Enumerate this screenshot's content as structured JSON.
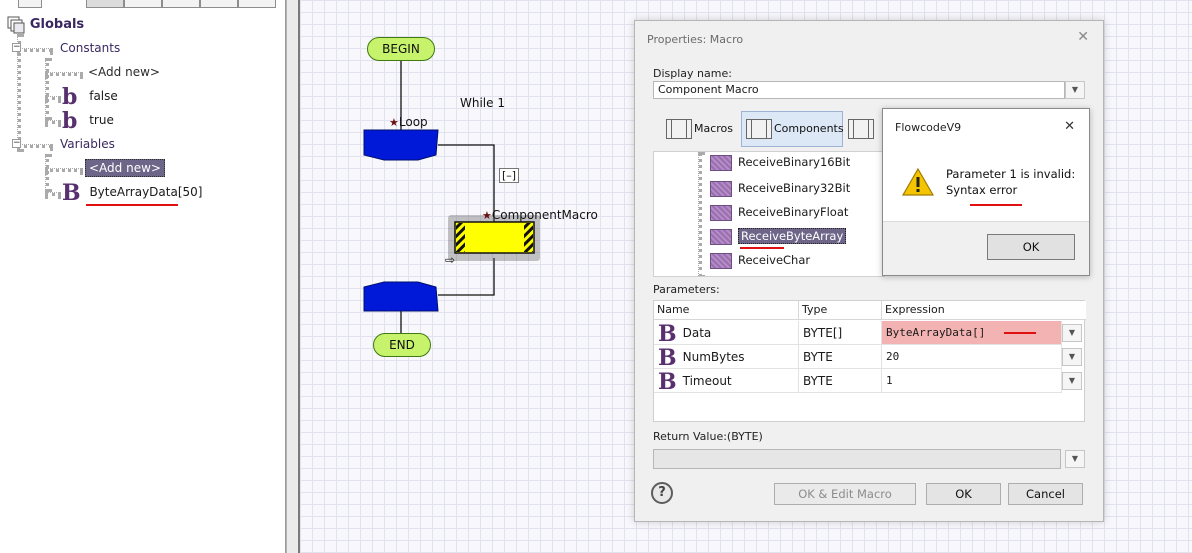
{
  "tree": {
    "globals_label": "Globals",
    "constants_label": "Constants",
    "add_new_label": "<Add new>",
    "constants": [
      {
        "icon": "b",
        "name": "false"
      },
      {
        "icon": "b",
        "name": "true"
      }
    ],
    "variables_label": "Variables",
    "variable_add_new_label": "<Add new>",
    "variables": [
      {
        "icon": "B",
        "name": "ByteArrayData[50]"
      }
    ]
  },
  "flowchart": {
    "begin_label": "BEGIN",
    "end_label": "END",
    "loop_label": "Loop",
    "while_label": "While 1",
    "collapse_label": "[–]",
    "component_macro_label": "ComponentMacro",
    "colors": {
      "terminal": "#c6f26c",
      "loop": "#0018d8",
      "macro": "#ffff00"
    }
  },
  "properties": {
    "title": "Properties: Macro",
    "close_glyph": "✕",
    "display_name_label": "Display name:",
    "display_name_value": "Component Macro",
    "tabs": {
      "macros": "Macros",
      "components": "Components"
    },
    "macro_list": [
      "ReceiveBinary16Bit",
      "ReceiveBinary32Bit",
      "ReceiveBinaryFloat",
      "ReceiveByteArray",
      "ReceiveChar"
    ],
    "selected_macro": "ReceiveByteArray",
    "parameters_label": "Parameters:",
    "columns": [
      "Name",
      "Type",
      "Expression"
    ],
    "parameters": [
      {
        "icon": "B",
        "name": "Data",
        "type": "BYTE[]",
        "expression": "ByteArrayData[]"
      },
      {
        "icon": "B",
        "name": "NumBytes",
        "type": "BYTE",
        "expression": "20"
      },
      {
        "icon": "B",
        "name": "Timeout",
        "type": "BYTE",
        "expression": "1"
      }
    ],
    "return_value_label": "Return Value:(BYTE)",
    "return_value": "",
    "help_glyph": "?",
    "buttons": {
      "ok_edit": "OK & Edit Macro",
      "ok": "OK",
      "cancel": "Cancel"
    }
  },
  "error_popup": {
    "title": "FlowcodeV9",
    "close_glyph": "✕",
    "message_line1": "Parameter 1 is invalid:",
    "message_line2": "Syntax error",
    "ok_label": "OK",
    "colors": {
      "warning": "#f5c400",
      "underline": "#e01010"
    }
  }
}
